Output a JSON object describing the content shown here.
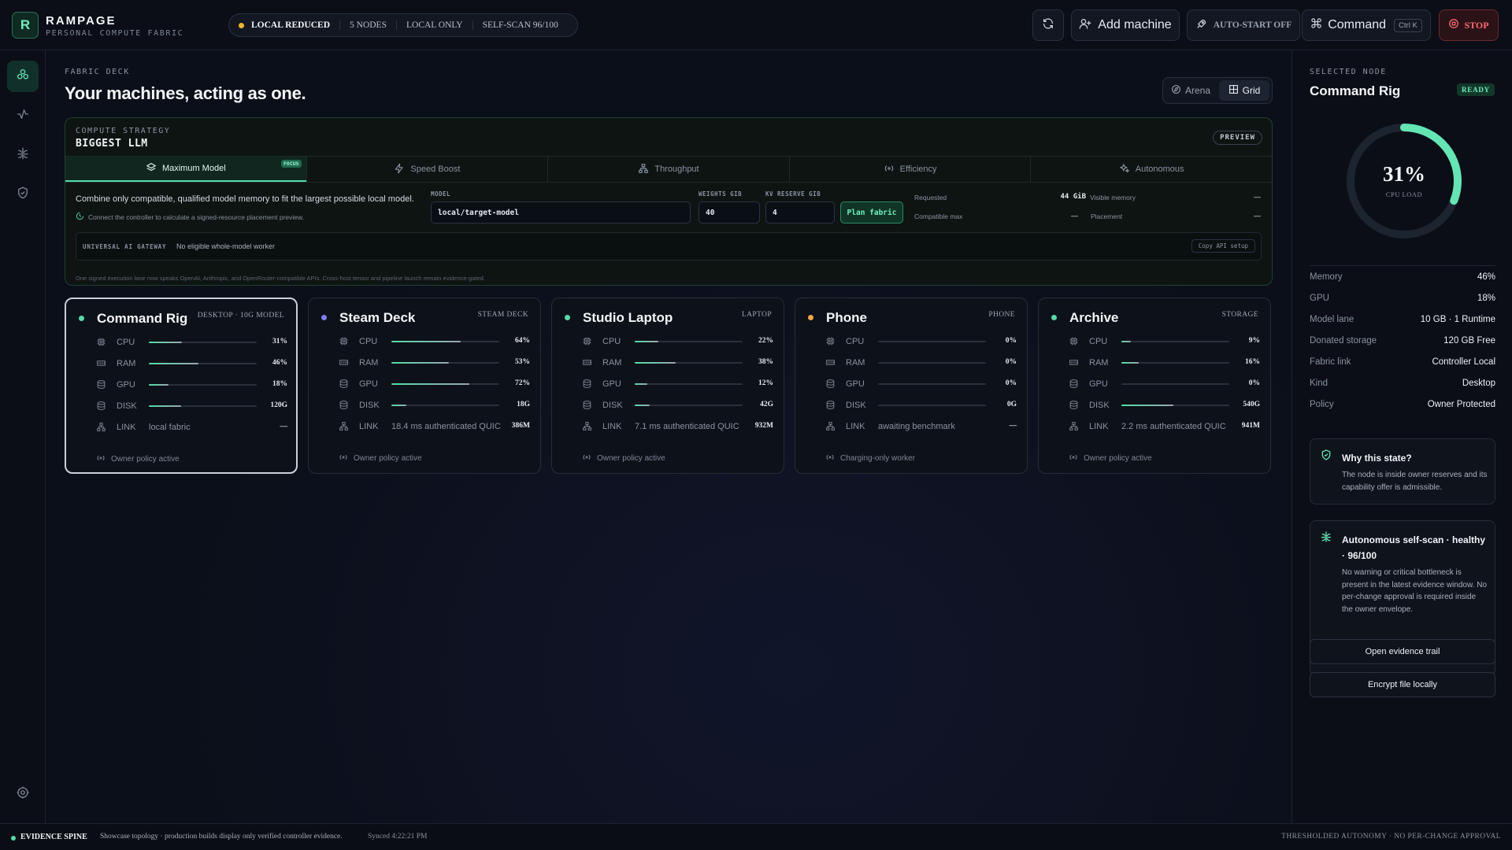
{
  "app": {
    "logo_letter": "R",
    "name": "RAMPAGE",
    "subtitle": "PERSONAL COMPUTE FABRIC"
  },
  "status_pill": {
    "mode": "LOCAL REDUCED",
    "nodes": "5 NODES",
    "scope": "LOCAL ONLY",
    "self_scan": "SELF-SCAN 96/100",
    "dot_color": "#f0b429"
  },
  "toolbar": {
    "refresh_icon": "refresh-icon",
    "add_machine": "Add machine",
    "auto_start": "AUTO-START OFF",
    "command": "Command",
    "command_shortcut": "Ctrl K",
    "stop": "STOP"
  },
  "rail": {
    "items": [
      "fabric-icon",
      "activity-icon",
      "scan-icon",
      "shield-icon"
    ],
    "bottom": "settings-icon"
  },
  "main": {
    "eyebrow": "FABRIC DECK",
    "title": "Your machines, acting as one.",
    "view_toggle": {
      "arena": "Arena",
      "grid": "Grid",
      "selected": "Grid"
    }
  },
  "strategy": {
    "eyebrow": "COMPUTE STRATEGY",
    "name": "BIGGEST LLM",
    "preview_badge": "PREVIEW",
    "tabs": [
      {
        "label": "Maximum Model",
        "icon": "layers-icon",
        "active": true,
        "badge": "FOCUS"
      },
      {
        "label": "Speed Boost",
        "icon": "bolt-icon",
        "active": false
      },
      {
        "label": "Throughput",
        "icon": "network-icon",
        "active": false
      },
      {
        "label": "Efficiency",
        "icon": "efficiency-icon",
        "active": false
      },
      {
        "label": "Autonomous",
        "icon": "sparkle-icon",
        "active": false
      }
    ],
    "description": "Combine only compatible, qualified model memory to fit the largest possible local model.",
    "hint": "Connect the controller to calculate a signed-resource placement preview.",
    "model_label": "MODEL",
    "model_value": "local/target-model",
    "weights_label": "WEIGHTS GIB",
    "weights_value": "40",
    "kv_label": "KV RESERVE GIB",
    "kv_value": "4",
    "plan_button": "Plan fabric",
    "requested_label": "Requested",
    "requested_value": "44 GiB",
    "visible_memory_label": "Visible memory",
    "visible_memory_value": "—",
    "compatible_max_label": "Compatible max",
    "compatible_max_value": "—",
    "placement_label": "Placement",
    "placement_value": "—",
    "gateway_label": "UNIVERSAL AI GATEWAY",
    "gateway_text": "No eligible whole-model worker",
    "gateway_button": "Copy API setup",
    "footnote": "One signed execution lane now speaks OpenAI, Anthropic, and OpenRouter-compatible APIs. Cross-host tensor and pipeline launch remain evidence-gated."
  },
  "nodes": [
    {
      "name": "Command Rig",
      "kind": "DESKTOP · 10G MODEL",
      "dot": "#53dca8",
      "selected": true,
      "cpu": 31,
      "ram": 46,
      "gpu": 18,
      "disk": "120G",
      "disk_pct": 30,
      "cpu_label": "31%",
      "ram_label": "46%",
      "gpu_label": "18%",
      "link": "local fabric",
      "link_val": "—",
      "foot": "Owner policy active"
    },
    {
      "name": "Steam Deck",
      "kind": "STEAM DECK",
      "dot": "#7c80f0",
      "selected": false,
      "cpu": 64,
      "ram": 53,
      "gpu": 72,
      "disk": "18G",
      "disk_pct": 14,
      "cpu_label": "64%",
      "ram_label": "53%",
      "gpu_label": "72%",
      "link": "18.4 ms authenticated QUIC",
      "link_val": "386M",
      "foot": "Owner policy active"
    },
    {
      "name": "Studio Laptop",
      "kind": "LAPTOP",
      "dot": "#53dca8",
      "selected": false,
      "cpu": 22,
      "ram": 38,
      "gpu": 12,
      "disk": "42G",
      "disk_pct": 14,
      "cpu_label": "22%",
      "ram_label": "38%",
      "gpu_label": "12%",
      "link": "7.1 ms authenticated QUIC",
      "link_val": "932M",
      "foot": "Owner policy active"
    },
    {
      "name": "Phone",
      "kind": "PHONE",
      "dot": "#f0a64a",
      "selected": false,
      "cpu": 0,
      "ram": 0,
      "gpu": 0,
      "disk": "0G",
      "disk_pct": 0,
      "cpu_label": "0%",
      "ram_label": "0%",
      "gpu_label": "0%",
      "link": "awaiting benchmark",
      "link_val": "—",
      "foot": "Charging-only worker"
    },
    {
      "name": "Archive",
      "kind": "STORAGE",
      "dot": "#53dca8",
      "selected": false,
      "cpu": 9,
      "ram": 16,
      "gpu": 0,
      "disk": "540G",
      "disk_pct": 48,
      "cpu_label": "9%",
      "ram_label": "16%",
      "gpu_label": "0%",
      "link": "2.2 ms authenticated QUIC",
      "link_val": "941M",
      "foot": "Owner policy active"
    }
  ],
  "row_labels": {
    "cpu": "CPU",
    "ram": "RAM",
    "gpu": "GPU",
    "disk": "DISK",
    "link": "LINK"
  },
  "side": {
    "eyebrow": "SELECTED NODE",
    "title": "Command Rig",
    "badge": "READY",
    "gauge_value": "31%",
    "gauge_fraction": 0.31,
    "gauge_label": "CPU LOAD",
    "details": [
      {
        "k": "Memory",
        "v": "46%"
      },
      {
        "k": "GPU",
        "v": "18%"
      },
      {
        "k": "Model lane",
        "v": "10 GB · 1 Runtime"
      },
      {
        "k": "Donated storage",
        "v": "120 GB Free"
      },
      {
        "k": "Fabric link",
        "v": "Controller Local"
      },
      {
        "k": "Kind",
        "v": "Desktop"
      },
      {
        "k": "Policy",
        "v": "Owner Protected"
      }
    ],
    "why_title": "Why this state?",
    "why_text": "The node is inside owner reserves and its capability offer is admissible.",
    "auto_title": "Autonomous self-scan · healthy · 96/100",
    "auto_text": "No warning or critical bottleneck is present in the latest evidence window. No per-change approval is required inside the owner envelope.",
    "evidence_button": "Open evidence trail",
    "encrypt_button": "Encrypt file locally"
  },
  "bottom": {
    "spine": "EVIDENCE SPINE",
    "text": "Showcase topology · production builds display only verified controller evidence.",
    "synced": "Synced 4:22:21 PM",
    "right": "THRESHOLDED AUTONOMY · NO PER-CHANGE APPROVAL"
  },
  "colors": {
    "accent": "#53dca8",
    "warning": "#f0b429",
    "danger": "#ff6b70"
  }
}
